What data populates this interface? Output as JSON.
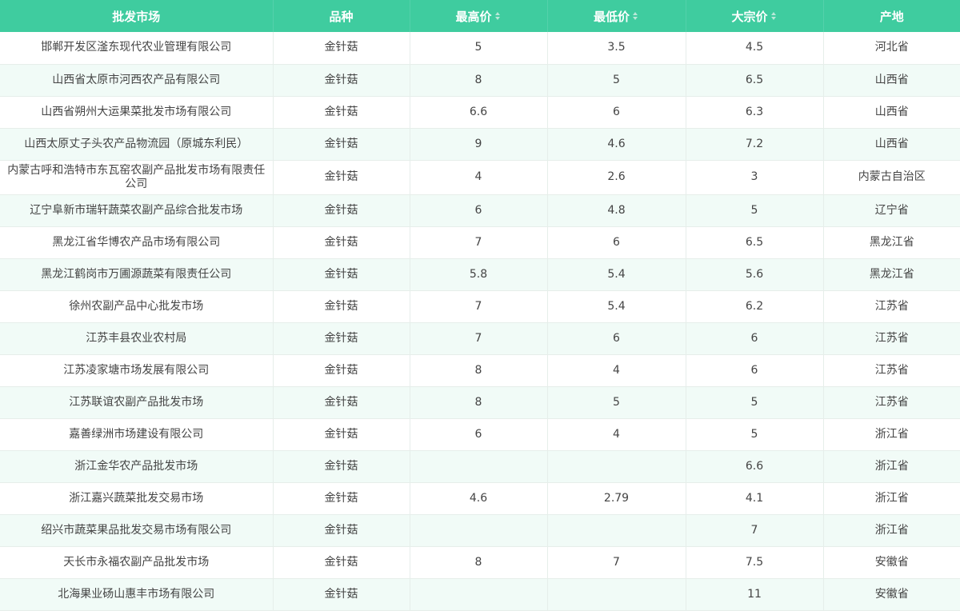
{
  "table": {
    "headers": [
      "批发市场",
      "品种",
      "最高价",
      "最低价",
      "大宗价",
      "产地"
    ],
    "sortable_columns": [
      2,
      3,
      4
    ],
    "colors": {
      "header_bg": "#3fcc9f",
      "header_text": "#ffffff",
      "row_alt_bg": "#f1fbf7",
      "cell_text": "#444444"
    },
    "rows": [
      [
        "邯郸开发区滏东现代农业管理有限公司",
        "金针菇",
        "5",
        "3.5",
        "4.5",
        "河北省"
      ],
      [
        "山西省太原市河西农产品有限公司",
        "金针菇",
        "8",
        "5",
        "6.5",
        "山西省"
      ],
      [
        "山西省朔州大运果菜批发市场有限公司",
        "金针菇",
        "6.6",
        "6",
        "6.3",
        "山西省"
      ],
      [
        "山西太原丈子头农产品物流园（原城东利民）",
        "金针菇",
        "9",
        "4.6",
        "7.2",
        "山西省"
      ],
      [
        "内蒙古呼和浩特市东瓦窑农副产品批发市场有限责任公司",
        "金针菇",
        "4",
        "2.6",
        "3",
        "内蒙古自治区"
      ],
      [
        "辽宁阜新市瑞轩蔬菜农副产品综合批发市场",
        "金针菇",
        "6",
        "4.8",
        "5",
        "辽宁省"
      ],
      [
        "黑龙江省华博农产品市场有限公司",
        "金针菇",
        "7",
        "6",
        "6.5",
        "黑龙江省"
      ],
      [
        "黑龙江鹤岗市万圃源蔬菜有限责任公司",
        "金针菇",
        "5.8",
        "5.4",
        "5.6",
        "黑龙江省"
      ],
      [
        "徐州农副产品中心批发市场",
        "金针菇",
        "7",
        "5.4",
        "6.2",
        "江苏省"
      ],
      [
        "江苏丰县农业农村局",
        "金针菇",
        "7",
        "6",
        "6",
        "江苏省"
      ],
      [
        "江苏凌家塘市场发展有限公司",
        "金针菇",
        "8",
        "4",
        "6",
        "江苏省"
      ],
      [
        "江苏联谊农副产品批发市场",
        "金针菇",
        "8",
        "5",
        "5",
        "江苏省"
      ],
      [
        "嘉善绿洲市场建设有限公司",
        "金针菇",
        "6",
        "4",
        "5",
        "浙江省"
      ],
      [
        "浙江金华农产品批发市场",
        "金针菇",
        "",
        "",
        "6.6",
        "浙江省"
      ],
      [
        "浙江嘉兴蔬菜批发交易市场",
        "金针菇",
        "4.6",
        "2.79",
        "4.1",
        "浙江省"
      ],
      [
        "绍兴市蔬菜果品批发交易市场有限公司",
        "金针菇",
        "",
        "",
        "7",
        "浙江省"
      ],
      [
        "天长市永福农副产品批发市场",
        "金针菇",
        "8",
        "7",
        "7.5",
        "安徽省"
      ],
      [
        "北海果业砀山惠丰市场有限公司",
        "金针菇",
        "",
        "",
        "11",
        "安徽省"
      ]
    ]
  }
}
